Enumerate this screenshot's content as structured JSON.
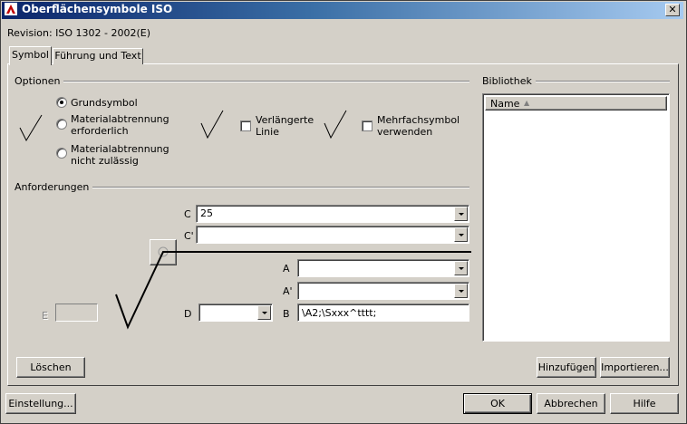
{
  "window": {
    "title": "Oberflächensymbole ISO",
    "close_glyph": "✕",
    "icon": "app-logo-icon"
  },
  "revision": "Revision: ISO 1302 - 2002(E)",
  "tabs": [
    {
      "label": "Symbol",
      "active": true
    },
    {
      "label": "Führung und Text",
      "active": false
    }
  ],
  "options": {
    "group_label": "Optionen",
    "radios": [
      {
        "label": "Grundsymbol",
        "checked": true
      },
      {
        "label_line1": "Materialabtrennung",
        "label_line2": "erforderlich",
        "checked": false
      },
      {
        "label_line1": "Materialabtrennung",
        "label_line2": "nicht zulässig",
        "checked": false
      }
    ],
    "extended_line": {
      "label_line1": "Verlängerte",
      "label_line2": "Linie",
      "checked": false
    },
    "multiple_symbol": {
      "label_line1": "Mehrfachsymbol",
      "label_line2": "verwenden",
      "checked": false
    }
  },
  "requirements": {
    "group_label": "Anforderungen",
    "c": {
      "label": "C",
      "value": "25"
    },
    "c_prime": {
      "label": "C'",
      "value": ""
    },
    "a": {
      "label": "A",
      "value": ""
    },
    "a_prime": {
      "label": "A'",
      "value": ""
    },
    "d": {
      "label": "D",
      "value": ""
    },
    "b": {
      "label": "B",
      "value": "\\A2;\\Sxxx^tttt;"
    },
    "e": {
      "label": "E",
      "value": ""
    }
  },
  "library": {
    "group_label": "Bibliothek",
    "column_name": "Name",
    "sort_glyph": "▲"
  },
  "buttons": {
    "clear": "Löschen",
    "add": "Hinzufügen",
    "import": "Importieren...",
    "settings": "Einstellung...",
    "ok": "OK",
    "cancel": "Abbrechen",
    "help": "Hilfe"
  },
  "colors": {
    "titlebar_start": "#0a246a",
    "titlebar_end": "#a6caf0",
    "face": "#d4d0c8"
  }
}
